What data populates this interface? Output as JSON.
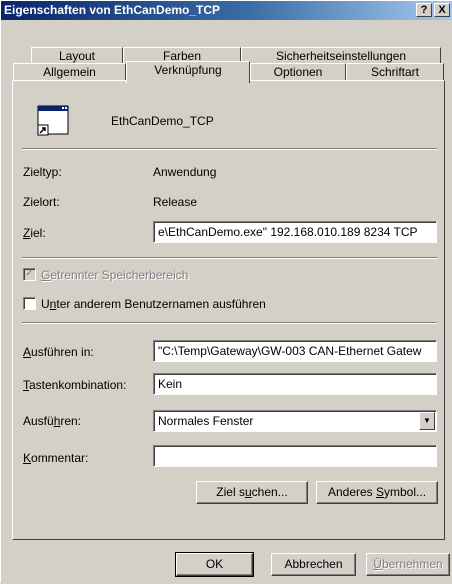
{
  "window": {
    "title": "Eigenschaften von EthCanDemo_TCP",
    "help_btn": "?",
    "close_btn": "X"
  },
  "tabs_back": [
    {
      "label": "Layout"
    },
    {
      "label": "Farben"
    },
    {
      "label": "Sicherheitseinstellungen"
    }
  ],
  "tabs_front": [
    {
      "label": "Allgemein"
    },
    {
      "label": "Verknüpfung"
    },
    {
      "label": "Optionen"
    },
    {
      "label": "Schriftart"
    }
  ],
  "shortcut": {
    "name": "EthCanDemo_TCP"
  },
  "info": {
    "zieltyp_label": "Zieltyp:",
    "zieltyp_value": "Anwendung",
    "zielort_label": "Zielort:",
    "zielort_value": "Release",
    "ziel_label_u": "Z",
    "ziel_label_rest": "iel:",
    "ziel_value": "e\\EthCanDemo.exe\" 192.168.010.189 8234 TCP"
  },
  "options": {
    "separate_memory_pre": "G",
    "separate_memory_rest": "etrennter Speicherbereich",
    "separate_memory_checked": "✓",
    "other_user_pre": "U",
    "other_user_u": "n",
    "other_user_rest": "ter anderem Benutzernamen ausführen"
  },
  "fields": {
    "run_in_u": "A",
    "run_in_rest": "usführen in:",
    "run_in_value": "\"C:\\Temp\\Gateway\\GW-003 CAN-Ethernet Gatew",
    "hotkey_u": "T",
    "hotkey_rest": "astenkombination:",
    "hotkey_value": "Kein",
    "run_pre": "Ausfü",
    "run_u": "h",
    "run_rest": "ren:",
    "run_value": "Normales Fenster",
    "comment_u": "K",
    "comment_rest": "ommentar:",
    "comment_value": ""
  },
  "buttons": {
    "find_target_pre": "Ziel s",
    "find_target_u": "u",
    "find_target_rest": "chen...",
    "change_icon_pre": "Anderes ",
    "change_icon_u": "S",
    "change_icon_rest": "ymbol...",
    "ok": "OK",
    "cancel": "Abbrechen",
    "apply_u": "Ü",
    "apply_rest": "bernehmen"
  }
}
